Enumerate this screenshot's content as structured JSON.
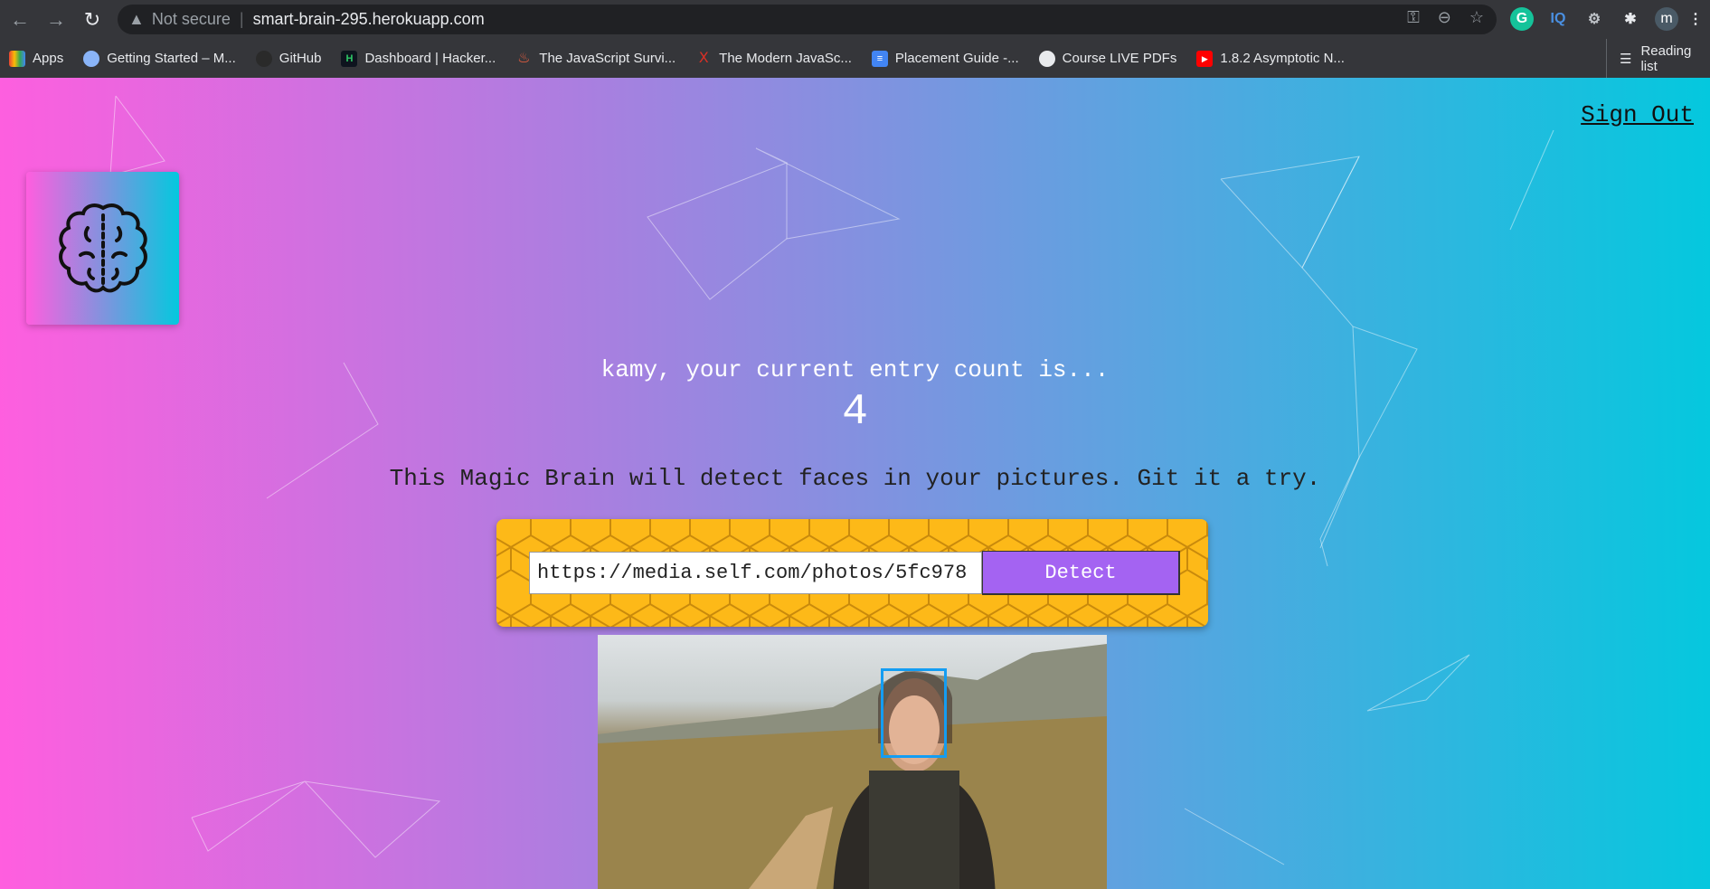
{
  "browser": {
    "security_label": "Not secure",
    "url": "smart-brain-295.herokuapp.com",
    "extensions": [
      {
        "name": "grammarly",
        "label": "G",
        "color": "#15c39a"
      },
      {
        "name": "iq",
        "label": "IQ",
        "color": "#4a90e2"
      },
      {
        "name": "settings",
        "label": "⚙",
        "color": "#bdc1c6"
      },
      {
        "name": "puzzle",
        "label": "✱",
        "color": "#e8eaed"
      }
    ],
    "profile_initial": "m",
    "bookmarks": [
      {
        "label": "Apps",
        "icon": "apps-grid-icon"
      },
      {
        "label": "Getting Started – M...",
        "icon": "owl-icon"
      },
      {
        "label": "GitHub",
        "icon": "github-icon"
      },
      {
        "label": "Dashboard | Hacker...",
        "icon": "hackerrank-icon"
      },
      {
        "label": "The JavaScript Survi...",
        "icon": "flame-icon"
      },
      {
        "label": "The Modern JavaSc...",
        "icon": "tower-icon"
      },
      {
        "label": "Placement Guide -...",
        "icon": "docs-icon"
      },
      {
        "label": "Course LIVE PDFs",
        "icon": "globe-icon"
      },
      {
        "label": "1.8.2 Asymptotic N...",
        "icon": "youtube-icon"
      }
    ],
    "reading_list": "Reading list"
  },
  "app": {
    "sign_out": "Sign Out",
    "rank_text": "kamy, your current entry count is...",
    "entry_count": "4",
    "intro": "This Magic Brain will detect faces in your pictures. Git it a try.",
    "image_url": "https://media.self.com/photos/5fc978",
    "detect_label": "Detect",
    "colors": {
      "form_bg": "#fdb918",
      "button": "#a463f2",
      "face_box": "#149df2"
    }
  }
}
